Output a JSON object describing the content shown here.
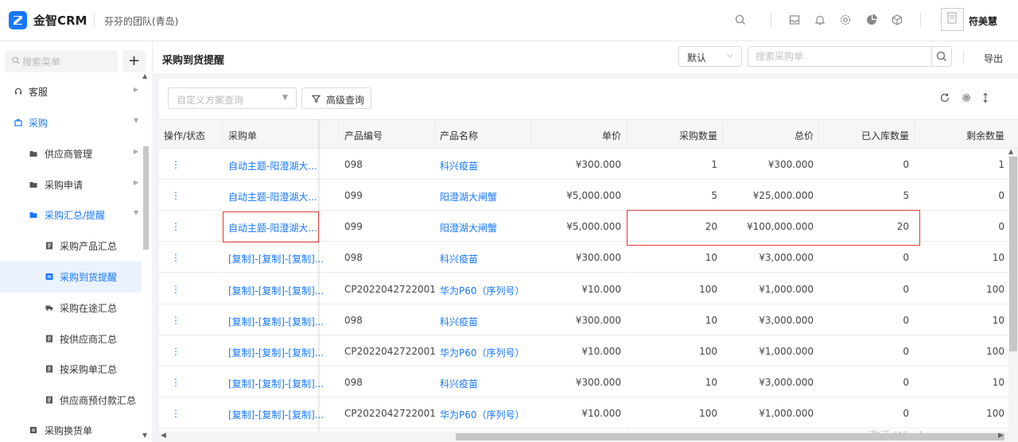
{
  "app": {
    "brand": "金智CRM",
    "team": "芬芬的团队(青岛)",
    "user": "符美慧"
  },
  "sidebar": {
    "search_placeholder": "搜索菜单",
    "add_label": "+",
    "items": [
      {
        "label": "客服",
        "icon": "headset-icon",
        "level": 0
      },
      {
        "label": "采购",
        "icon": "cart-icon",
        "level": 0
      },
      {
        "label": "供应商管理",
        "icon": "folder-icon",
        "level": 1
      },
      {
        "label": "采购申请",
        "icon": "folder-icon",
        "level": 1
      },
      {
        "label": "采购汇总/提醒",
        "icon": "folder-icon",
        "level": 1
      },
      {
        "label": "采购产品汇总",
        "icon": "report-icon",
        "level": 2
      },
      {
        "label": "采购到货提醒",
        "icon": "report-icon",
        "level": 2
      },
      {
        "label": "采购在途汇总",
        "icon": "truck-icon",
        "level": 2
      },
      {
        "label": "按供应商汇总",
        "icon": "report-icon",
        "level": 2
      },
      {
        "label": "按采购单汇总",
        "icon": "report-icon",
        "level": 2
      },
      {
        "label": "供应商预付款汇总",
        "icon": "report-icon",
        "level": 2
      },
      {
        "label": "采购换货单",
        "icon": "doc-icon",
        "level": 1
      }
    ]
  },
  "header": {
    "title": "采购到货提醒",
    "view_select": "默认",
    "search_placeholder": "搜索采购单",
    "export_label": "导出"
  },
  "toolbar": {
    "scheme_placeholder": "自定义方案查询",
    "advanced_label": "高级查询"
  },
  "table": {
    "columns": [
      "操作/状态",
      "采购单",
      "产品编号",
      "产品名称",
      "单价",
      "采购数量",
      "总价",
      "已入库数量",
      "剩余数量"
    ],
    "rows": [
      {
        "op": "⋮",
        "order": "自动主题-阳澄湖大...",
        "code": "098",
        "name": "科兴疫苗",
        "price": "¥300.000",
        "qty": "1",
        "total": "¥300.000",
        "stocked": "0",
        "remain": "1"
      },
      {
        "op": "⋮",
        "order": "自动主题-阳澄湖大...",
        "code": "099",
        "name": "阳澄湖大闸蟹",
        "price": "¥5,000.000",
        "qty": "5",
        "total": "¥25,000.000",
        "stocked": "5",
        "remain": "0"
      },
      {
        "op": "⋮",
        "order": "自动主题-阳澄湖大...",
        "code": "099",
        "name": "阳澄湖大闸蟹",
        "price": "¥5,000.000",
        "qty": "20",
        "total": "¥100,000.000",
        "stocked": "20",
        "remain": "0"
      },
      {
        "op": "⋮",
        "order": "[复制]-[复制]-[复制]...",
        "code": "098",
        "name": "科兴疫苗",
        "price": "¥300.000",
        "qty": "10",
        "total": "¥3,000.000",
        "stocked": "0",
        "remain": "10"
      },
      {
        "op": "⋮",
        "order": "[复制]-[复制]-[复制]...",
        "code": "CP2022042722001",
        "name": "华为P60（序列号）",
        "price": "¥10.000",
        "qty": "100",
        "total": "¥1,000.000",
        "stocked": "0",
        "remain": "100"
      },
      {
        "op": "⋮",
        "order": "[复制]-[复制]-[复制]...",
        "code": "098",
        "name": "科兴疫苗",
        "price": "¥300.000",
        "qty": "10",
        "total": "¥3,000.000",
        "stocked": "0",
        "remain": "10"
      },
      {
        "op": "⋮",
        "order": "[复制]-[复制]-[复制]...",
        "code": "CP2022042722001",
        "name": "华为P60（序列号）",
        "price": "¥10.000",
        "qty": "100",
        "total": "¥1,000.000",
        "stocked": "0",
        "remain": "100"
      },
      {
        "op": "⋮",
        "order": "[复制]-[复制]-[复制]...",
        "code": "098",
        "name": "科兴疫苗",
        "price": "¥300.000",
        "qty": "10",
        "total": "¥3,000.000",
        "stocked": "0",
        "remain": "10"
      },
      {
        "op": "⋮",
        "order": "[复制]-[复制]-[复制]...",
        "code": "CP2022042722001",
        "name": "华为P60（序列号）",
        "price": "¥10.000",
        "qty": "100",
        "total": "¥1,000.000",
        "stocked": "0",
        "remain": "100"
      }
    ]
  },
  "watermark": "激活 Windows",
  "colors": {
    "accent": "#1677ff",
    "highlight": "#e53935"
  }
}
